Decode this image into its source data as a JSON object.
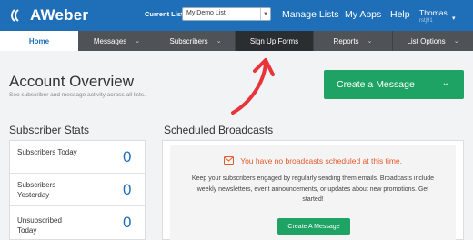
{
  "header": {
    "logo_text": "AWeber",
    "current_list_label": "Current List:",
    "current_list_value": "My Demo List",
    "links": [
      "Manage Lists",
      "My Apps",
      "Help"
    ],
    "user_name": "Thomas",
    "user_sub": "rstj91"
  },
  "nav": {
    "items": [
      {
        "label": "Home",
        "active": true
      },
      {
        "label": "Messages"
      },
      {
        "label": "Subscribers"
      },
      {
        "label": "Sign Up Forms",
        "highlighted": true
      },
      {
        "label": "Reports"
      },
      {
        "label": "List Options"
      }
    ]
  },
  "overview": {
    "title": "Account Overview",
    "subtitle": "See subscriber and message activity across all lists.",
    "create_button": "Create a Message"
  },
  "stats": {
    "title": "Subscriber Stats",
    "rows": [
      {
        "label": "Subscribers Today",
        "value": "0"
      },
      {
        "label": "Subscribers Yesterday",
        "value": "0"
      },
      {
        "label": "Unsubscribed Today",
        "value": "0"
      }
    ]
  },
  "broadcasts": {
    "title": "Scheduled Broadcasts",
    "alert": "You have no broadcasts scheduled at this time.",
    "body": "Keep your subscribers engaged by regularly sending them emails. Broadcasts include weekly newsletters, event announcements, or updates about new promotions. Get started!",
    "button": "Create A Message"
  },
  "colors": {
    "brand_blue": "#1f6fb8",
    "nav_gray": "#4f5357",
    "accent_green": "#1fa364",
    "alert_orange": "#e25b2c",
    "annotation_red": "#e8343a"
  }
}
